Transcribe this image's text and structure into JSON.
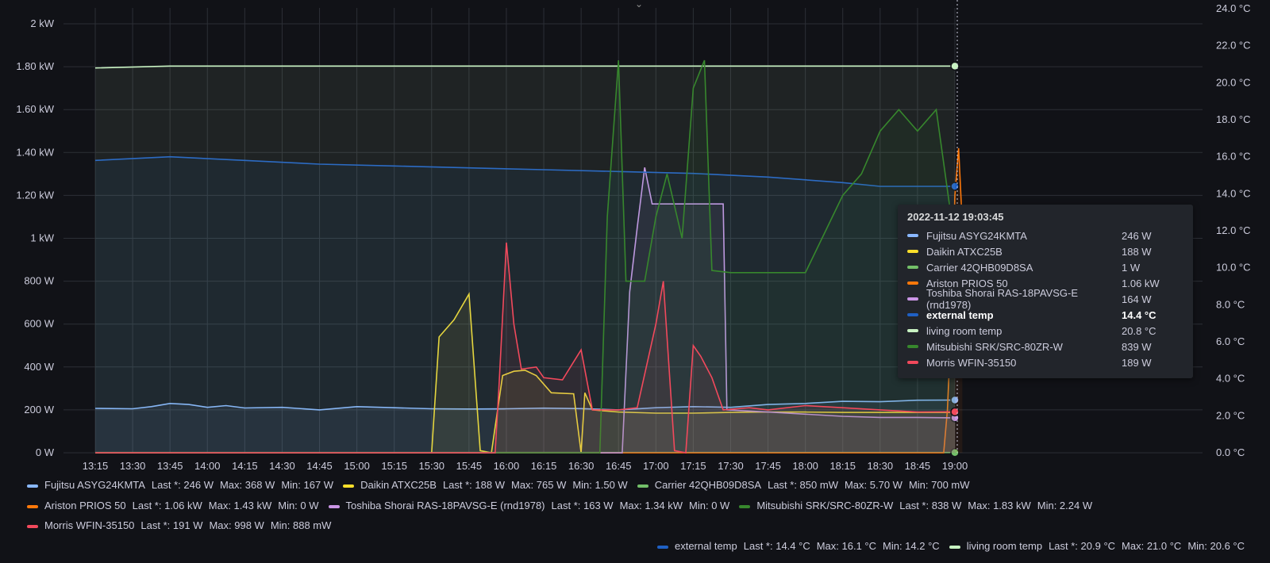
{
  "chart_data": {
    "type": "line",
    "x": [
      "13:15",
      "13:30",
      "13:45",
      "14:00",
      "14:15",
      "14:30",
      "14:45",
      "15:00",
      "15:15",
      "15:30",
      "15:45",
      "16:00",
      "16:15",
      "16:30",
      "16:45",
      "17:00",
      "17:15",
      "17:30",
      "17:45",
      "18:00",
      "18:15",
      "18:30",
      "18:45",
      "19:00"
    ],
    "y_left_ticks": [
      "0 W",
      "200 W",
      "400 W",
      "600 W",
      "800 W",
      "1 kW",
      "1.20 kW",
      "1.40 kW",
      "1.60 kW",
      "1.80 kW",
      "2 kW"
    ],
    "y_right_ticks": [
      "0.0 °C",
      "2.0 °C",
      "4.0 °C",
      "6.0 °C",
      "8.0 °C",
      "10.0 °C",
      "12.0 °C",
      "14.0 °C",
      "16.0 °C",
      "18.0 °C",
      "20.0 °C",
      "22.0 °C",
      "24.0 °C"
    ],
    "ylim_left_w": [
      0,
      2000
    ],
    "ylim_right_c": [
      0,
      24
    ],
    "grid": true,
    "legend_placement": "bottom",
    "series": [
      {
        "name": "Fujitsu ASYG24KMTA",
        "color": "#8ab8ff",
        "axis": "left",
        "last": "246 W",
        "max": "368 W",
        "min": "167 W",
        "points": [
          [
            0,
            207
          ],
          [
            1,
            205
          ],
          [
            1.5,
            215
          ],
          [
            2,
            230
          ],
          [
            2.5,
            225
          ],
          [
            3,
            212
          ],
          [
            3.5,
            220
          ],
          [
            4,
            209
          ],
          [
            5,
            212
          ],
          [
            6,
            200
          ],
          [
            7,
            215
          ],
          [
            8,
            210
          ],
          [
            9,
            205
          ],
          [
            10,
            204
          ],
          [
            11,
            205
          ],
          [
            12,
            208
          ],
          [
            13,
            206
          ],
          [
            14,
            200
          ],
          [
            15,
            210
          ],
          [
            16,
            215
          ],
          [
            17,
            212
          ],
          [
            18,
            225
          ],
          [
            19,
            230
          ],
          [
            20,
            240
          ],
          [
            21,
            238
          ],
          [
            22,
            245
          ],
          [
            23,
            246
          ]
        ]
      },
      {
        "name": "Daikin ATXC25B",
        "color": "#fade2a",
        "axis": "left",
        "last": "188 W",
        "max": "765 W",
        "min": "1.50 W",
        "points": [
          [
            0,
            0
          ],
          [
            9,
            0
          ],
          [
            9.2,
            540
          ],
          [
            9.6,
            620
          ],
          [
            10,
            740
          ],
          [
            10.3,
            10
          ],
          [
            10.6,
            0
          ],
          [
            10.9,
            360
          ],
          [
            11.2,
            380
          ],
          [
            11.5,
            385
          ],
          [
            11.8,
            360
          ],
          [
            12.2,
            280
          ],
          [
            12.8,
            275
          ],
          [
            13,
            0
          ],
          [
            13.1,
            280
          ],
          [
            13.3,
            200
          ],
          [
            14,
            190
          ],
          [
            15,
            185
          ],
          [
            16,
            185
          ],
          [
            17,
            188
          ],
          [
            18,
            190
          ],
          [
            19,
            190
          ],
          [
            20,
            188
          ],
          [
            21,
            188
          ],
          [
            22,
            188
          ],
          [
            23,
            188
          ]
        ]
      },
      {
        "name": "Carrier 42QHB09D8SA",
        "color": "#73bf69",
        "axis": "left",
        "last": "850 mW",
        "max": "5.70 W",
        "min": "700 mW",
        "points": [
          [
            0,
            1
          ],
          [
            23,
            1
          ]
        ]
      },
      {
        "name": "Ariston PRIOS 50",
        "color": "#ff780a",
        "axis": "left",
        "last": "1.06 kW",
        "max": "1.43 kW",
        "min": "0 W",
        "points": [
          [
            0,
            0
          ],
          [
            22.7,
            0
          ],
          [
            22.8,
            200
          ],
          [
            22.9,
            600
          ],
          [
            23,
            1200
          ],
          [
            23.1,
            1420
          ],
          [
            23.2,
            1060
          ]
        ]
      },
      {
        "name": "Toshiba Shorai RAS-18PAVSG-E (rnd1978)",
        "color": "#ca95e5",
        "axis": "left",
        "last": "163 W",
        "max": "1.34 kW",
        "min": "0 W",
        "points": [
          [
            0,
            0
          ],
          [
            14.1,
            0
          ],
          [
            14.3,
            750
          ],
          [
            14.5,
            1050
          ],
          [
            14.7,
            1330
          ],
          [
            14.9,
            1160
          ],
          [
            16.8,
            1160
          ],
          [
            16.9,
            200
          ],
          [
            18,
            190
          ],
          [
            19,
            180
          ],
          [
            20,
            170
          ],
          [
            21,
            165
          ],
          [
            22,
            165
          ],
          [
            23,
            163
          ]
        ]
      },
      {
        "name": "external temp",
        "color": "#1f60c4",
        "axis": "right",
        "last": "14.4 °C",
        "max": "16.1 °C",
        "min": "14.2 °C",
        "points": [
          [
            0,
            15.8
          ],
          [
            2,
            16.0
          ],
          [
            4,
            15.8
          ],
          [
            6,
            15.6
          ],
          [
            8,
            15.5
          ],
          [
            10,
            15.4
          ],
          [
            12,
            15.3
          ],
          [
            14,
            15.2
          ],
          [
            16,
            15.1
          ],
          [
            18,
            14.9
          ],
          [
            20,
            14.6
          ],
          [
            21,
            14.4
          ],
          [
            22,
            14.4
          ],
          [
            23,
            14.4
          ]
        ]
      },
      {
        "name": "living room temp",
        "color": "#c8f2c2",
        "axis": "right",
        "last": "20.9 °C",
        "max": "21.0 °C",
        "min": "20.6 °C",
        "points": [
          [
            0,
            20.8
          ],
          [
            2,
            20.9
          ],
          [
            4,
            20.9
          ],
          [
            6,
            20.9
          ],
          [
            8,
            20.9
          ],
          [
            10,
            20.9
          ],
          [
            12,
            20.9
          ],
          [
            14,
            20.9
          ],
          [
            16,
            20.9
          ],
          [
            18,
            20.9
          ],
          [
            20,
            20.9
          ],
          [
            22,
            20.9
          ],
          [
            23,
            20.9
          ]
        ]
      },
      {
        "name": "Mitsubishi SRK/SRC-80ZR-W",
        "color": "#37872d",
        "axis": "left",
        "last": "838 W",
        "max": "1.83 kW",
        "min": "2.24 W",
        "points": [
          [
            0,
            0
          ],
          [
            13.5,
            0
          ],
          [
            13.7,
            1100
          ],
          [
            14,
            1830
          ],
          [
            14.2,
            800
          ],
          [
            14.7,
            800
          ],
          [
            15,
            1100
          ],
          [
            15.3,
            1300
          ],
          [
            15.7,
            1000
          ],
          [
            16,
            1700
          ],
          [
            16.3,
            1830
          ],
          [
            16.5,
            850
          ],
          [
            17,
            840
          ],
          [
            18,
            840
          ],
          [
            19,
            840
          ],
          [
            20,
            1200
          ],
          [
            20.5,
            1300
          ],
          [
            21,
            1500
          ],
          [
            21.5,
            1600
          ],
          [
            22,
            1500
          ],
          [
            22.5,
            1600
          ],
          [
            22.9,
            1100
          ],
          [
            23,
            839
          ]
        ]
      },
      {
        "name": "Morris WFIN-35150",
        "color": "#f2495c",
        "axis": "left",
        "last": "191 W",
        "max": "998 W",
        "min": "888 mW",
        "points": [
          [
            0,
            0
          ],
          [
            10.7,
            0
          ],
          [
            10.8,
            300
          ],
          [
            11,
            980
          ],
          [
            11.2,
            600
          ],
          [
            11.4,
            390
          ],
          [
            11.8,
            400
          ],
          [
            12,
            350
          ],
          [
            12.5,
            340
          ],
          [
            13,
            480
          ],
          [
            13.3,
            200
          ],
          [
            14,
            200
          ],
          [
            14.5,
            210
          ],
          [
            15,
            600
          ],
          [
            15.2,
            800
          ],
          [
            15.5,
            10
          ],
          [
            15.8,
            0
          ],
          [
            16,
            500
          ],
          [
            16.2,
            450
          ],
          [
            16.5,
            350
          ],
          [
            16.8,
            200
          ],
          [
            17.5,
            210
          ],
          [
            18,
            200
          ],
          [
            19,
            220
          ],
          [
            20,
            210
          ],
          [
            21,
            200
          ],
          [
            22,
            190
          ],
          [
            23,
            191
          ]
        ]
      }
    ],
    "tooltip": {
      "time": "2022-11-12 19:03:45",
      "rows": [
        {
          "name": "Fujitsu ASYG24KMTA",
          "value": "246 W",
          "color": "#8ab8ff"
        },
        {
          "name": "Daikin ATXC25B",
          "value": "188 W",
          "color": "#fade2a"
        },
        {
          "name": "Carrier 42QHB09D8SA",
          "value": "1 W",
          "color": "#73bf69"
        },
        {
          "name": "Ariston PRIOS 50",
          "value": "1.06 kW",
          "color": "#ff780a"
        },
        {
          "name": "Toshiba Shorai RAS-18PAVSG-E (rnd1978)",
          "value": "164 W",
          "color": "#ca95e5"
        },
        {
          "name": "external temp",
          "value": "14.4 °C",
          "color": "#1f60c4",
          "bold": true
        },
        {
          "name": "living room temp",
          "value": "20.8 °C",
          "color": "#c8f2c2"
        },
        {
          "name": "Mitsubishi SRK/SRC-80ZR-W",
          "value": "839 W",
          "color": "#37872d"
        },
        {
          "name": "Morris WFIN-35150",
          "value": "189 W",
          "color": "#f2495c"
        }
      ]
    }
  },
  "legend_labels": {
    "last": "Last *:",
    "max": "Max:",
    "min": "Min:"
  },
  "collapse_icon": "chevron-down-icon"
}
